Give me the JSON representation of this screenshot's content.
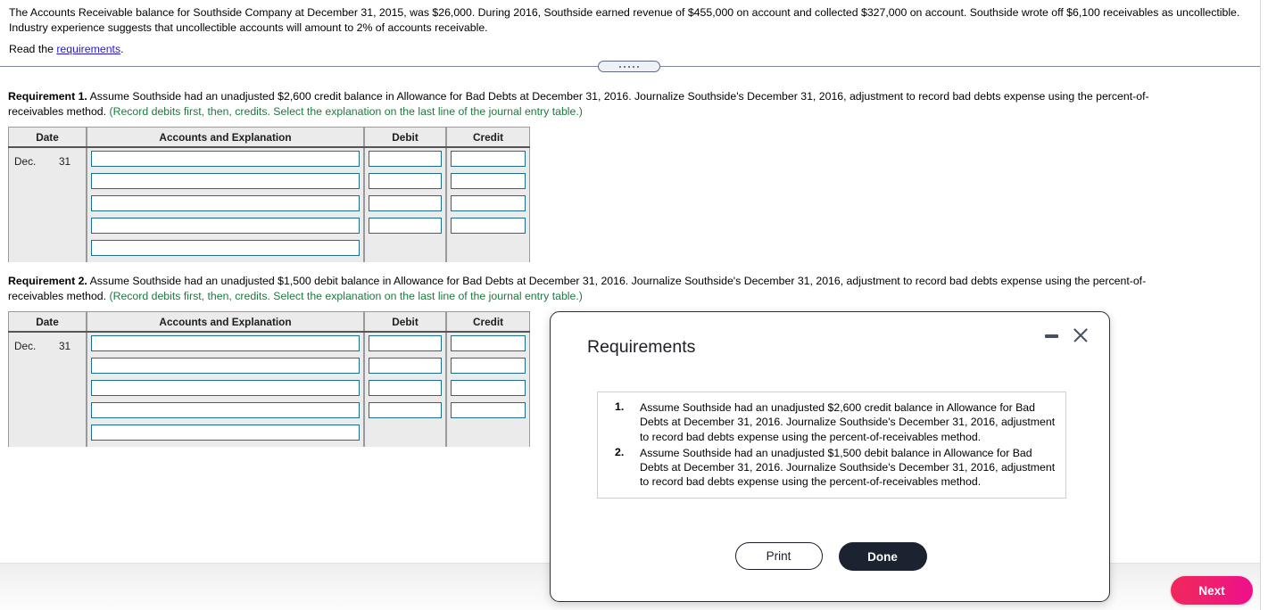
{
  "problem": {
    "statement": "The Accounts Receivable balance for Southside Company at December 31, 2015, was $26,000. During 2016, Southside earned revenue of $455,000 on account and collected $327,000 on account. Southside wrote off $6,100 receivables as uncollectible. Industry experience suggests that uncollectible accounts will amount to 2% of accounts receivable.",
    "read_prefix": "Read the ",
    "read_link": "requirements",
    "read_suffix": "."
  },
  "requirement1": {
    "label": "Requirement 1.",
    "text": " Assume Southside had an unadjusted $2,600 credit balance in Allowance for Bad Debts at December 31, 2016. Journalize Southside's December 31, 2016, adjustment to record bad debts expense using the percent-of-receivables method. ",
    "hint": "(Record debits first, then, credits. Select the explanation on the last line of the journal entry table.)"
  },
  "requirement2": {
    "label": "Requirement 2.",
    "text": " Assume Southside had an unadjusted $1,500 debit balance in Allowance for Bad Debts at December 31, 2016. Journalize Southside's December 31, 2016, adjustment to record bad debts expense using the percent-of-receivables method. ",
    "hint": "(Record debits first, then, credits. Select the explanation on the last line of the journal entry table.)"
  },
  "journal_table": {
    "headers": {
      "date": "Date",
      "accounts": "Accounts and Explanation",
      "debit": "Debit",
      "credit": "Credit"
    },
    "date_month": "Dec.",
    "date_day": "31",
    "rows": [
      {
        "account": "",
        "debit": "",
        "credit": ""
      },
      {
        "account": "",
        "debit": "",
        "credit": ""
      },
      {
        "account": "",
        "debit": "",
        "credit": ""
      },
      {
        "account": "",
        "debit": "",
        "credit": ""
      },
      {
        "account": "",
        "debit": null,
        "credit": null
      }
    ]
  },
  "dialog": {
    "title": "Requirements",
    "minimize_icon": "minimize-icon",
    "close_icon": "close-icon",
    "items": [
      {
        "number": "1.",
        "text": "Assume Southside had an unadjusted $2,600 credit balance in Allowance for Bad Debts at December 31, 2016. Journalize Southside's December 31, 2016, adjustment to record bad debts expense using the percent-of-receivables method."
      },
      {
        "number": "2.",
        "text": "Assume Southside had an unadjusted $1,500 debit balance in Allowance for Bad Debts at December 31, 2016. Journalize Southside's December 31, 2016, adjustment to record bad debts expense using the percent-of-receivables method."
      }
    ],
    "print_label": "Print",
    "done_label": "Done"
  },
  "footer": {
    "next_label": "Next"
  },
  "colors": {
    "link": "#2418d8",
    "hint_green": "#1a7a3c",
    "field_border": "#1c6e8c",
    "next_gradient_start": "#f0285a",
    "next_gradient_end": "#ef0e8e",
    "done_bg": "#1b2230"
  }
}
